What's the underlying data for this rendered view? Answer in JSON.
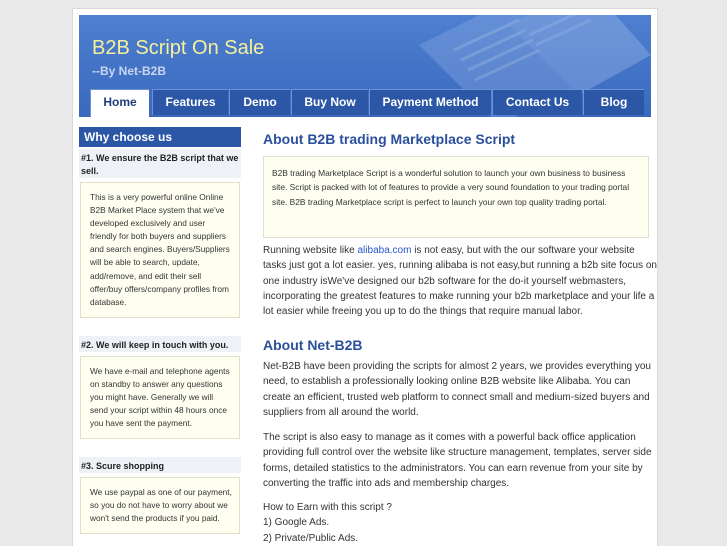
{
  "site": {
    "title": "B2B Script On Sale",
    "subtitle": "--By Net-B2B"
  },
  "nav": {
    "items": [
      {
        "label": "Home"
      },
      {
        "label": "Features"
      },
      {
        "label": "Demo"
      },
      {
        "label": "Buy Now"
      },
      {
        "label": "Payment Method"
      },
      {
        "label": "Contact Us"
      },
      {
        "label": "Blog"
      }
    ],
    "active": "Home"
  },
  "sidebar": {
    "title": "Why choose us",
    "blocks": [
      {
        "heading": "#1. We ensure the B2B script that we sell.",
        "text": "This is a very powerful online Online B2B Market Place system that we've developed exclusively and user friendly for both buyers and suppliers and search engines. Buyers/Suppliers will be able to search, update, add/remove, and edit their sell offer/buy offers/company profiles from database."
      },
      {
        "heading": "#2. We will keep in touch with you.",
        "text": "We have e-mail and telephone agents on standby to answer any questions you might have. Generally we will send your script within 48 hours once you have sent the payment."
      },
      {
        "heading": "#3. Scure shopping",
        "text": "We use paypal as one of our payment, so you do not have to worry about we won't send the products if you paid."
      }
    ]
  },
  "main": {
    "heading1": "About B2B trading Marketplace Script",
    "quote": "B2B trading Marketplace Script is a wonderful solution to launch your own business to business site. Script is packed with lot of features to provide a very sound foundation to your trading portal site. B2B trading Marketplace script is perfect to launch your own top quality trading portal.",
    "para1_before": "Running website like ",
    "para1_link": "alibaba.com",
    "para1_after": " is not easy, but with the our software your website tasks just got a lot easier. yes, running alibaba is not easy,but running a b2b site focus on one industry isWe've designed our b2b software for the do-it yourself webmasters, incorporating the greatest features to make running your b2b marketplace and your life a lot easier while freeing you up to do the things that require manual labor.",
    "heading2": "About Net-B2B",
    "para2": "Net-B2B have been providing the scripts for almost 2 years, we provides everything you need, to establish a professionally looking online B2B website like Alibaba. You can create an efficient, trusted web platform to connect small and medium-sized buyers and suppliers from all around the world.",
    "para3": "The script is also easy to manage as it comes with a powerful back office application providing full control over the website like structure management, templates, server side forms, detailed statistics to the administrators. You can earn revenue from your site by converting the traffic into ads and membership charges.",
    "earn_title": "How to Earn with this script ?",
    "earn_items": [
      "1) Google Ads.",
      "2) Private/Public Ads."
    ]
  },
  "colors": {
    "header_blue": "#3a69be",
    "nav_blue": "#2b57a6",
    "title_yellow": "#f7f09a",
    "heading_blue": "#2a4f9c",
    "link_blue": "#2a55c9",
    "box_bg": "#fffff1"
  }
}
